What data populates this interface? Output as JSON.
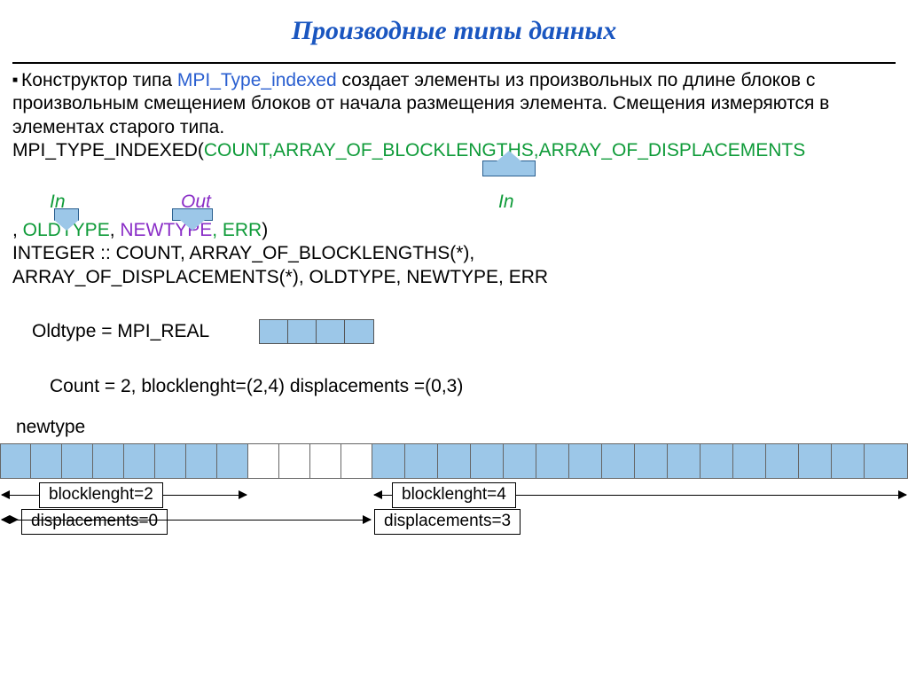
{
  "title": "Производные типы данных",
  "para": {
    "intro_before": "Конструктор типа ",
    "func": "MPI_Type_indexed",
    "intro_after": " создает элементы  из произвольных по длине блоков с произвольным смещением блоков от начала размещения элемента. Смещения измеряются в элементах старого типа.",
    "sig_prefix": "MPI_TYPE_INDEXED(",
    "sig_args": "COUNT,ARRAY_OF_BLOCKLENGTHS,ARRAY_OF_DISPLACEMENTS",
    "sig_line2_prefix": ", ",
    "sig_old": "OLDTYPE",
    "sig_sep": ", ",
    "sig_new": "NEWTYPE",
    "sig_err": ", ERR",
    "sig_close": ")",
    "decl1": "INTEGER :: COUNT, ARRAY_OF_BLOCKLENGTHS(*),",
    "decl2": "ARRAY_OF_DISPLACEMENTS(*), OLDTYPE, NEWTYPE, ERR"
  },
  "callouts": {
    "in1": "In",
    "out": "Out",
    "in2": "In"
  },
  "oldtype": "Oldtype  = MPI_REAL",
  "countline": "Count = 2, blocklenght=(2,4)  displacements  =(0,3)",
  "newtype": "newtype",
  "ann": {
    "bl2": "blocklenght=2",
    "bl4": "blocklenght=4",
    "d0": "displacements=0",
    "d3": "displacements=3"
  }
}
